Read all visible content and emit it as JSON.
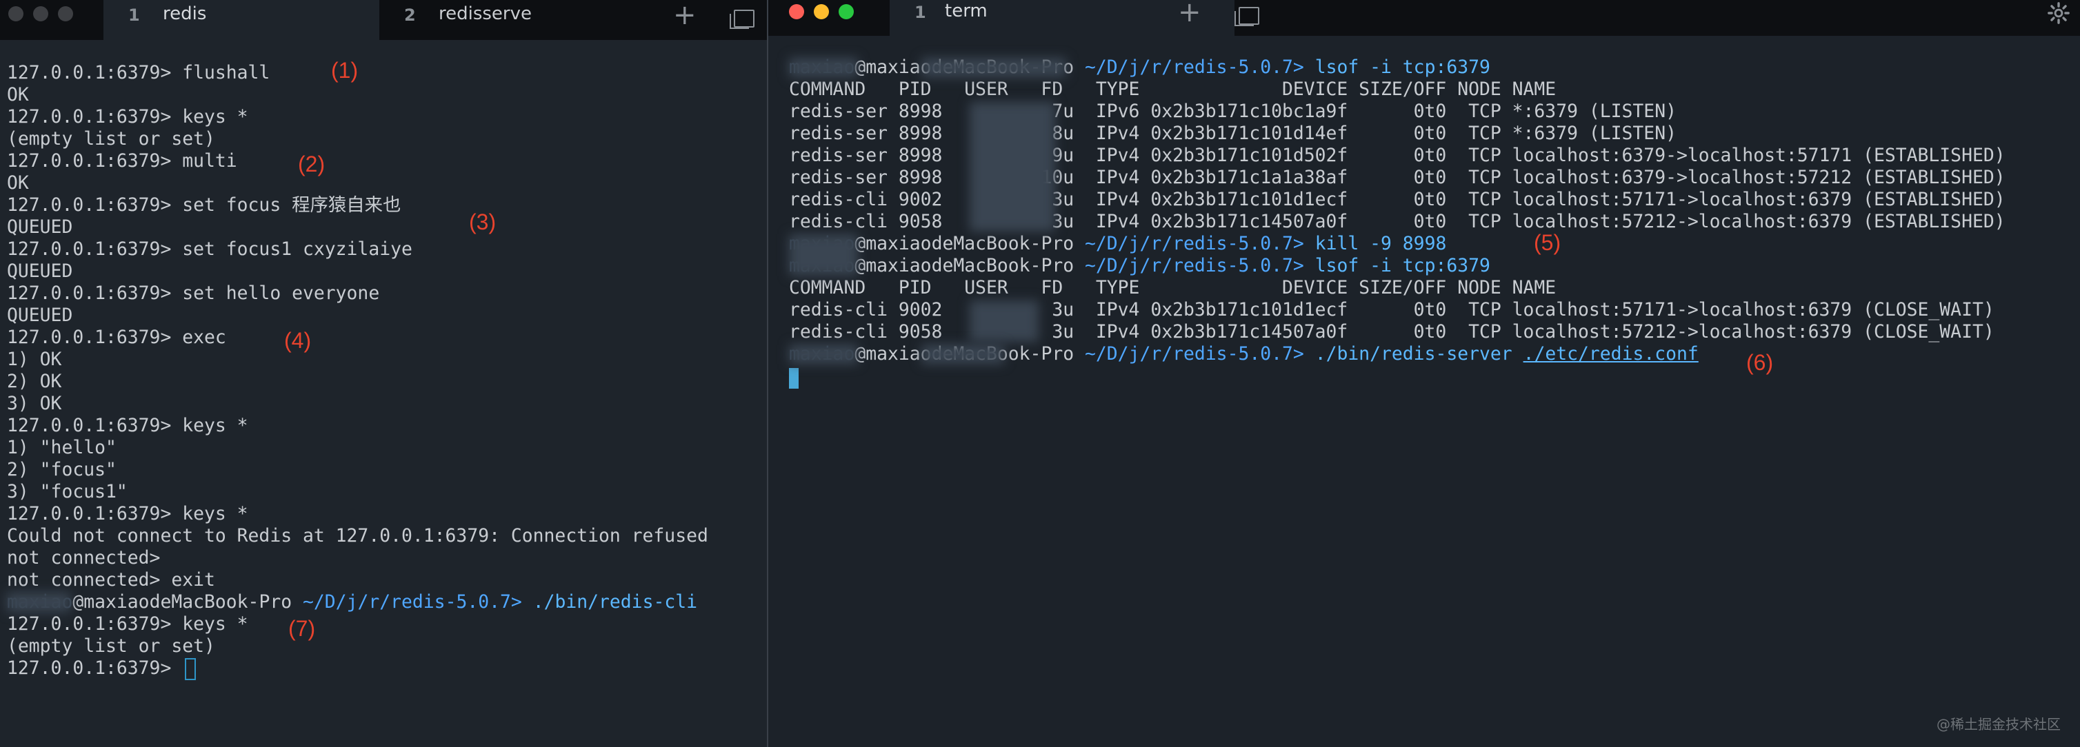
{
  "left_window": {
    "tabs": [
      {
        "num": "1",
        "label": "redis"
      },
      {
        "num": "2",
        "label": "redisserve"
      }
    ],
    "new_tab_glyph": "+",
    "icons": [
      "new-tab-icon",
      "window-icon"
    ],
    "lines": [
      "127.0.0.1:6379> flushall",
      "OK",
      "127.0.0.1:6379> keys *",
      "(empty list or set)",
      "127.0.0.1:6379> multi",
      "OK",
      "127.0.0.1:6379> set focus 程序猿自来也",
      "QUEUED",
      "127.0.0.1:6379> set focus1 cxyzilaiye",
      "QUEUED",
      "127.0.0.1:6379> set hello everyone",
      "QUEUED",
      "127.0.0.1:6379> exec",
      "1) OK",
      "2) OK",
      "3) OK",
      "127.0.0.1:6379> keys *",
      "1) \"hello\"",
      "2) \"focus\"",
      "3) \"focus1\"",
      "127.0.0.1:6379> keys *",
      "Could not connect to Redis at 127.0.0.1:6379: Connection refused",
      "not connected>",
      "not connected> exit"
    ],
    "prompt_line": {
      "faded": "maxiao",
      "host": "@maxiaodeMacBook-Pro",
      "path": "~/D/j/r/redis-5.0.7>",
      "cmd": "./bin/redis-cli"
    },
    "lines_after": [
      "127.0.0.1:6379> keys *",
      "(empty list or set)",
      "127.0.0.1:6379>"
    ],
    "annotations": [
      "(1)",
      "(2)",
      "(3)",
      "(4)",
      "(7)"
    ]
  },
  "right_window": {
    "tab": {
      "num": "1",
      "label": "term"
    },
    "new_tab_glyph": "+",
    "icons": [
      "new-tab-icon",
      "window-icon",
      "gear-icon"
    ],
    "prompt1": {
      "faded": "maxiao",
      "host": "@maxiaodeMacBook-Pro",
      "path": "~/D/j/r/redis-5.0.7>",
      "cmd": "lsof -i tcp:6379"
    },
    "table1_header": "COMMAND   PID   USER   FD   TYPE             DEVICE SIZE/OFF NODE NAME",
    "table1": [
      "redis-ser 8998          7u  IPv6 0x2b3b171c10bc1a9f      0t0  TCP *:6379 (LISTEN)",
      "redis-ser 8998          8u  IPv4 0x2b3b171c101d14ef      0t0  TCP *:6379 (LISTEN)",
      "redis-ser 8998          9u  IPv4 0x2b3b171c101d502f      0t0  TCP localhost:6379->localhost:57171 (ESTABLISHED)",
      "redis-ser 8998         10u  IPv4 0x2b3b171c1a1a38af      0t0  TCP localhost:6379->localhost:57212 (ESTABLISHED)",
      "redis-cli 9002          3u  IPv4 0x2b3b171c101d1ecf      0t0  TCP localhost:57171->localhost:6379 (ESTABLISHED)",
      "redis-cli 9058          3u  IPv4 0x2b3b171c14507a0f      0t0  TCP localhost:57212->localhost:6379 (ESTABLISHED)"
    ],
    "prompt2": {
      "faded": "maxiao",
      "host": "@maxiaodeMacBook-Pro",
      "path": "~/D/j/r/redis-5.0.7>",
      "cmd": "kill -9 8998"
    },
    "prompt3": {
      "faded": "maxiao",
      "host": "@maxiaodeMacBook-Pro",
      "path": "~/D/j/r/redis-5.0.7>",
      "cmd": "lsof -i tcp:6379"
    },
    "table2_header": "COMMAND   PID   USER   FD   TYPE             DEVICE SIZE/OFF NODE NAME",
    "table2": [
      "redis-cli 9002          3u  IPv4 0x2b3b171c101d1ecf      0t0  TCP localhost:57171->localhost:6379 (CLOSE_WAIT)",
      "redis-cli 9058          3u  IPv4 0x2b3b171c14507a0f      0t0  TCP localhost:57212->localhost:6379 (CLOSE_WAIT)"
    ],
    "prompt4": {
      "faded": "maxiao",
      "host": "@maxiaodeMacBook-Pro",
      "path": "~/D/j/r/redis-5.0.7>",
      "cmd": "./bin/redis-server",
      "arg": "./etc/redis.conf"
    },
    "annotations": [
      "(5)",
      "(6)"
    ]
  },
  "watermark": "@稀土掘金技术社区",
  "colors": {
    "annotation": "#e8432d",
    "prompt_path": "#50a7ff",
    "command": "#5cb8ff",
    "cursor": "#4aa9d8"
  }
}
